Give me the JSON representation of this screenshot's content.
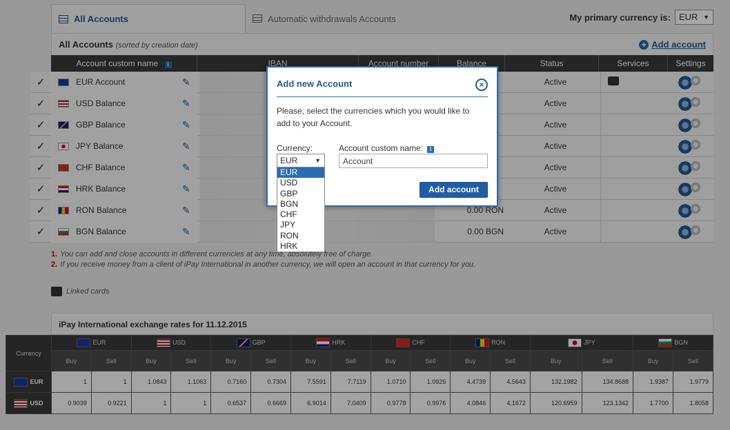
{
  "tabs": {
    "accounts": "All Accounts",
    "withdrawals": "Automatic withdrawals Accounts"
  },
  "primary_currency": {
    "label": "My primary currency is:",
    "value": "EUR"
  },
  "panel": {
    "title": "All Accounts",
    "subtitle": "(sorted by creation date)",
    "add_link": "Add account"
  },
  "table": {
    "headers": [
      "Account custom name",
      "IBAN",
      "Account number",
      "Balance",
      "Status",
      "Services",
      "Settings"
    ],
    "rows": [
      {
        "name": "EUR Account",
        "balance": "",
        "status": "Active",
        "flag": "eu"
      },
      {
        "name": "USD Balance",
        "balance": "",
        "status": "Active",
        "flag": "us"
      },
      {
        "name": "GBP Balance",
        "balance": "",
        "status": "Active",
        "flag": "gb"
      },
      {
        "name": "JPY Balance",
        "balance": "",
        "status": "Active",
        "flag": "jp"
      },
      {
        "name": "CHF Balance",
        "balance": "",
        "status": "Active",
        "flag": "ch"
      },
      {
        "name": "HRK Balance",
        "balance": "",
        "status": "Active",
        "flag": "hr"
      },
      {
        "name": "RON Balance",
        "balance": "0.00 RON",
        "status": "Active",
        "flag": "ro"
      },
      {
        "name": "BGN Balance",
        "balance": "0.00 BGN",
        "status": "Active",
        "flag": "bg"
      }
    ]
  },
  "notes": {
    "n1": "You can add and close accounts in different currencies at any time, absolutely free of charge.",
    "n2": "If you receive money from a client of iPay International in another currency, we will open an account in that currency for you.",
    "linked_cards": "Linked cards"
  },
  "rates": {
    "title": "iPay International exchange rates for 11.12.2015",
    "currency_col": "Currency",
    "buy": "Buy",
    "sell": "Sell",
    "currencies": [
      "EUR",
      "USD",
      "GBP",
      "HRK",
      "CHF",
      "RON",
      "JPY",
      "BGN"
    ],
    "rows": [
      {
        "cur": "EUR",
        "vals": [
          "1",
          "1",
          "1.0843",
          "1.1063",
          "0.7160",
          "0.7304",
          "7.5591",
          "7.7119",
          "1.0710",
          "1.0926",
          "4.4739",
          "4.5643",
          "132.1982",
          "134.8688",
          "1.9387",
          "1.9779"
        ]
      },
      {
        "cur": "USD",
        "vals": [
          "0.9039",
          "0.9221",
          "1",
          "1",
          "0.6537",
          "0.6669",
          "6.9014",
          "7.0409",
          "0.9778",
          "0.9976",
          "4.0846",
          "4.1672",
          "120.6959",
          "123.1342",
          "1.7700",
          "1.8058"
        ]
      }
    ]
  },
  "modal": {
    "title": "Add new Account",
    "close": "×",
    "text": "Please, select the currencies which you would like to add to your Account.",
    "currency_label": "Currency:",
    "name_label": "Account custom name:",
    "currency_value": "EUR",
    "name_value": "Account",
    "button": "Add account",
    "options": [
      "EUR",
      "USD",
      "GBP",
      "BGN",
      "CHF",
      "JPY",
      "RON",
      "HRK"
    ]
  },
  "colors": {
    "accent": "#1f5a8f",
    "button": "#1f5ea5",
    "header": "#3a3a3a"
  }
}
